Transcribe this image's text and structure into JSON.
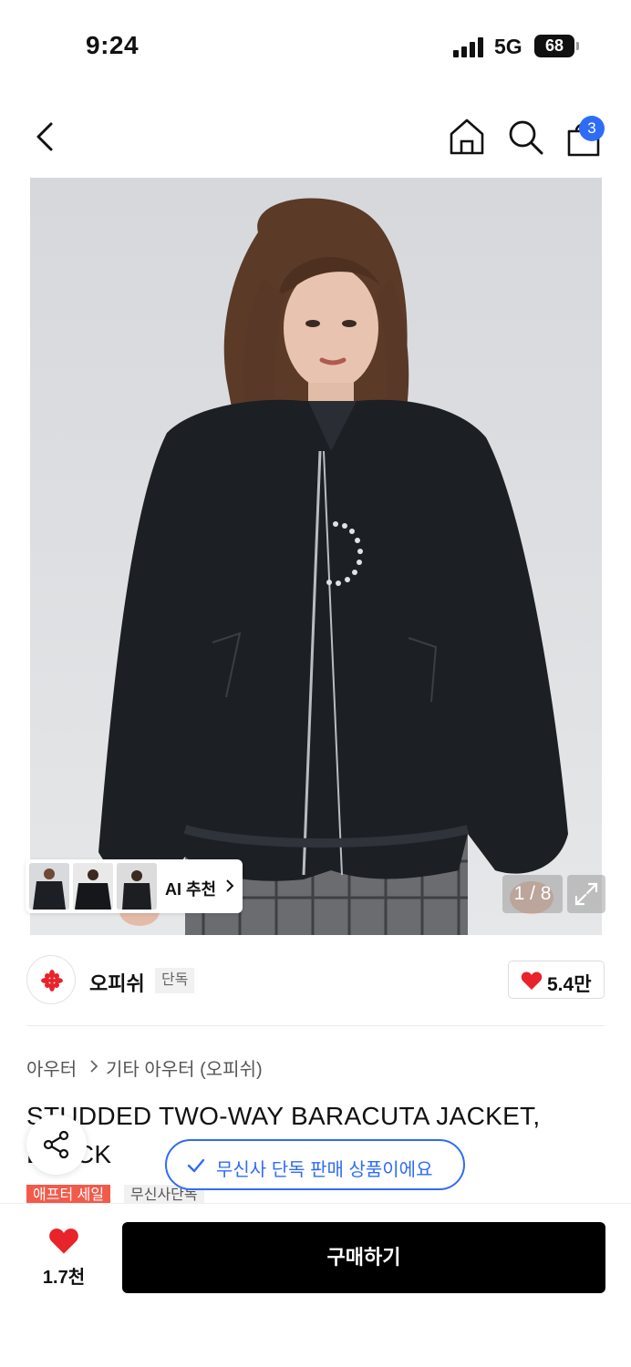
{
  "status_bar": {
    "time": "9:24",
    "network": "5G",
    "battery": "68"
  },
  "nav": {
    "cart_count": "3"
  },
  "gallery": {
    "page": "1 / 8",
    "ai_label": "AI 추천"
  },
  "brand": {
    "name": "오피쉬",
    "tag": "단독",
    "likes": "5.4만"
  },
  "category": {
    "level1": "아우터",
    "level2": "기타 아우터 (오피쉬)"
  },
  "product": {
    "title": "STUDDED TWO-WAY BARACUTA JACKET, BLACK",
    "tags": [
      "애프터 세일",
      "무신사단독"
    ]
  },
  "toast": {
    "text": "무신사 단독 판매 상품이에요"
  },
  "bottom": {
    "wish_count": "1.7천",
    "buy_label": "구매하기"
  },
  "colors": {
    "accent_blue": "#2f6cf6",
    "sale_red": "#f25a4a",
    "heart_red": "#e8232a",
    "buy_black": "#000000"
  },
  "icons": [
    "back-icon",
    "home-icon",
    "search-icon",
    "bag-icon",
    "expand-icon",
    "heart-icon",
    "share-icon",
    "check-icon"
  ]
}
